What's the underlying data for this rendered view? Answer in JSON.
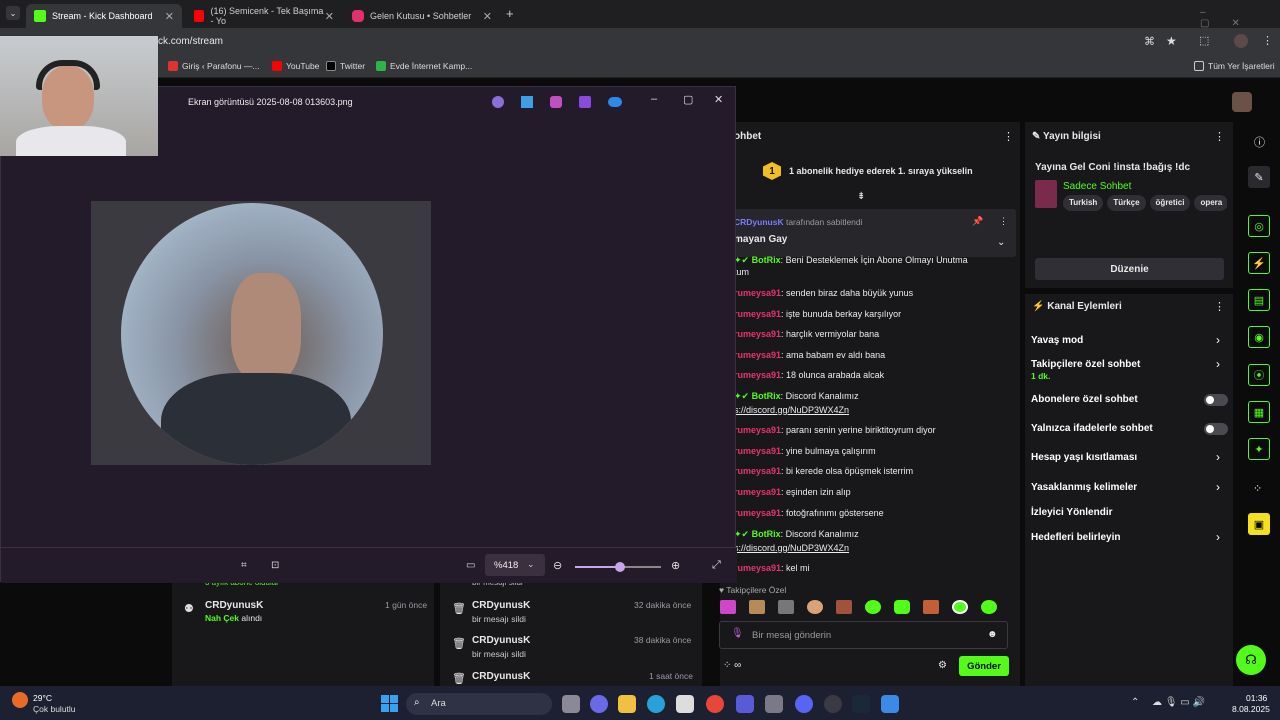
{
  "tabs": [
    {
      "label": "Stream - Kick Dashboard",
      "fav": "#53fc18"
    },
    {
      "label": "(16) Semicenk - Tek Başıma - Yo",
      "fav": "#ff0000"
    },
    {
      "label": "Gelen Kutusu • Sohbetler",
      "fav": "#e1306c"
    }
  ],
  "new_tab": "+",
  "url": "ck.com/stream",
  "bookmarks": [
    "Giriş ‹ Parafonu —...",
    "YouTube",
    "Twitter",
    "Evde İnternet Kamp..."
  ],
  "bookmarks_right": "Tüm Yer İşaretleri",
  "viewer": {
    "title": "Ekran görüntüsü 2025-08-08 013603.png",
    "zoom": "%418"
  },
  "activity": [
    {
      "user": "CRDyunusK",
      "action_green": "Nah Çek",
      "action": " alındı",
      "time": "1 gün önce"
    },
    {
      "user": "CRDyunusK",
      "action": "bir mesajı sildi",
      "time": "32 dakika önce"
    },
    {
      "user": "CRDyunusK",
      "action": "bir mesajı sildi",
      "time": "38 dakika önce"
    },
    {
      "user": "CRDyunusK",
      "action": "bir mesajı sildi",
      "time": "1 saat önce"
    }
  ],
  "activity_top": "3 aylık abone oldular",
  "activity_top2": "bir mesajı sildi",
  "chat": {
    "header": "ohbet",
    "promo": "1 abonelik hediye ederek 1. sıraya yükselin",
    "pinned_by": "CRDyunusK",
    "pinned_suffix": " tarafından sabitlendi",
    "pinned_msg": "mayan Gay",
    "lines": [
      {
        "user": "BotRix",
        "bot": true,
        "text": ": Beni Desteklemek İçin Abone Olmayı Unutma"
      },
      {
        "user": "",
        "text": "tum"
      },
      {
        "user": "rumeysa91",
        "text": ": senden biraz daha büyük yunus"
      },
      {
        "user": "rumeysa91",
        "text": ": işte bunuda berkay karşılıyor"
      },
      {
        "user": "rumeysa91",
        "text": ": harçlık vermiyolar bana"
      },
      {
        "user": "rumeysa91",
        "text": ": ama babam ev aldı bana"
      },
      {
        "user": "rumeysa91",
        "text": ": 18 olunca arabada alcak"
      },
      {
        "user": "BotRix",
        "bot": true,
        "text": ": Discord Kanalımız"
      },
      {
        "user": "",
        "text": "s://discord.gg/NuDP3WX4Zn",
        "link": true
      },
      {
        "user": "rumeysa91",
        "text": ": paranı senin yerine biriktitoyrum diyor"
      },
      {
        "user": "rumeysa91",
        "text": ": yine bulmaya çalışırım"
      },
      {
        "user": "rumeysa91",
        "text": ": bi kerede olsa öpüşmek isterrim"
      },
      {
        "user": "rumeysa91",
        "text": ": eşinden izin alıp"
      },
      {
        "user": "rumeysa91",
        "text": ": fotoğrafınımı göstersene"
      },
      {
        "user": "BotRix",
        "bot": true,
        "text": ": Discord Kanalımız"
      },
      {
        "user": "",
        "text": "s://discord.gg/NuDP3WX4Zn",
        "link": true
      },
      {
        "user": "rumeysa91",
        "text": ": kel mi"
      }
    ],
    "followers_only": "Takipçilere Özel",
    "input_placeholder": "Bir mesaj gönderin",
    "send": "Gönder"
  },
  "stream_info": {
    "title": "Yayın bilgisi",
    "stream_title": "Yayına Gel Coni !insta !bağış !dc",
    "category": "Sadece Sohbet",
    "tags": [
      "Turkish",
      "Türkçe",
      "öğretici",
      "opera"
    ],
    "edit": "Düzenie"
  },
  "channel_actions": {
    "title": "Kanal Eylemleri",
    "items": [
      {
        "label": "Yavaş mod",
        "kind": "chevron"
      },
      {
        "label": "Takipçilere özel sohbet",
        "sub": "1 dk.",
        "kind": "chevron"
      },
      {
        "label": "Abonelere özel sohbet",
        "kind": "toggle"
      },
      {
        "label": "Yalnızca ifadelerle sohbet",
        "kind": "toggle"
      },
      {
        "label": "Hesap yaşı kısıtlaması",
        "kind": "chevron"
      },
      {
        "label": "Yasaklanmış kelimeler",
        "kind": "chevron"
      },
      {
        "label": "İzleyici Yönlendir",
        "kind": "none"
      },
      {
        "label": "Hedefleri belirleyin",
        "kind": "chevron"
      }
    ]
  },
  "taskbar": {
    "weather_temp": "29°C",
    "weather_desc": "Çok bulutlu",
    "search": "Ara",
    "time": "01:36",
    "date": "8.08.2025"
  },
  "colors": {
    "kick_green": "#53fc18",
    "user_pink": "#e8336b"
  }
}
